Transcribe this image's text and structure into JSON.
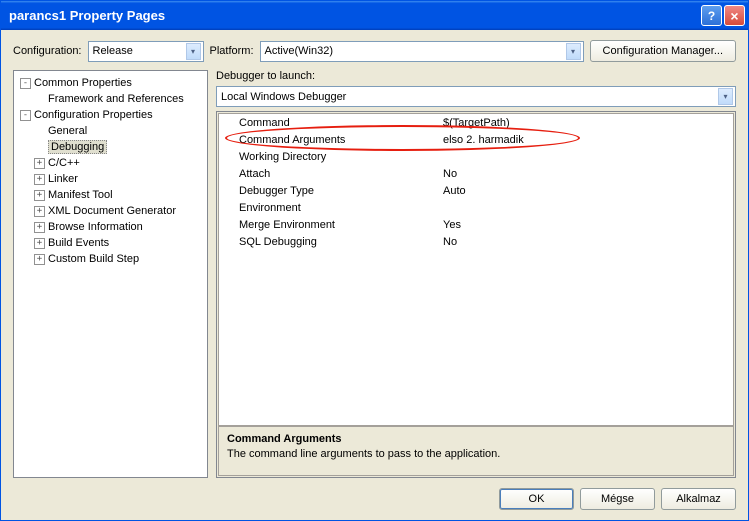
{
  "title": "parancs1 Property Pages",
  "topbar": {
    "configuration_label": "Configuration:",
    "configuration_value": "Release",
    "platform_label": "Platform:",
    "platform_value": "Active(Win32)",
    "config_mgr": "Configuration Manager..."
  },
  "tree": {
    "common_properties": "Common Properties",
    "framework_refs": "Framework and References",
    "config_properties": "Configuration Properties",
    "general": "General",
    "debugging": "Debugging",
    "cpp": "C/C++",
    "linker": "Linker",
    "manifest_tool": "Manifest Tool",
    "xml_doc_gen": "XML Document Generator",
    "browse_info": "Browse Information",
    "build_events": "Build Events",
    "custom_build": "Custom Build Step"
  },
  "launch": {
    "label": "Debugger to launch:",
    "value": "Local Windows Debugger"
  },
  "grid": {
    "rows": [
      {
        "k": "Command",
        "v": "$(TargetPath)"
      },
      {
        "k": "Command Arguments",
        "v": "elso 2. harmadik"
      },
      {
        "k": "Working Directory",
        "v": ""
      },
      {
        "k": "Attach",
        "v": "No"
      },
      {
        "k": "Debugger Type",
        "v": "Auto"
      },
      {
        "k": "Environment",
        "v": ""
      },
      {
        "k": "Merge Environment",
        "v": "Yes"
      },
      {
        "k": "SQL Debugging",
        "v": "No"
      }
    ]
  },
  "desc": {
    "title": "Command Arguments",
    "text": "The command line arguments to pass to the application."
  },
  "buttons": {
    "ok": "OK",
    "cancel": "Mégse",
    "apply": "Alkalmaz"
  }
}
